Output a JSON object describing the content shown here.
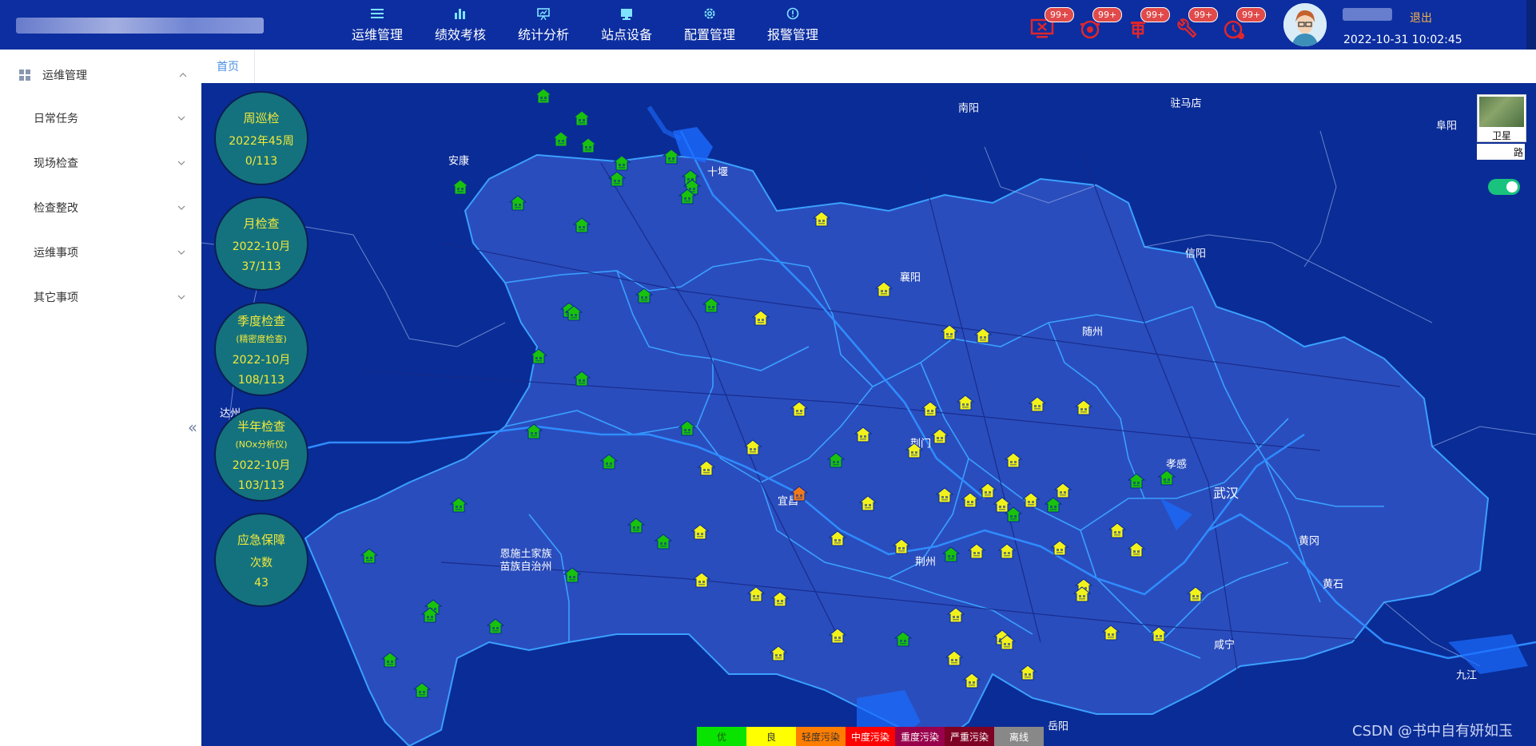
{
  "nav": {
    "items": [
      {
        "label": "运维管理",
        "icon": "list-icon"
      },
      {
        "label": "绩效考核",
        "icon": "bar-chart-icon"
      },
      {
        "label": "统计分析",
        "icon": "presentation-icon"
      },
      {
        "label": "站点设备",
        "icon": "monitor-icon"
      },
      {
        "label": "配置管理",
        "icon": "gear-icon"
      },
      {
        "label": "报警管理",
        "icon": "alert-icon"
      }
    ]
  },
  "alerts": [
    {
      "badge": "99+",
      "icon": "monitor-alert-icon"
    },
    {
      "badge": "99+",
      "icon": "camera-alert-icon"
    },
    {
      "badge": "99+",
      "icon": "audit-icon"
    },
    {
      "badge": "99+",
      "icon": "wrench-icon"
    },
    {
      "badge": "99+",
      "icon": "clock-alert-icon"
    }
  ],
  "header": {
    "logout": "退出",
    "datetime": "2022-10-31 10:02:45"
  },
  "sidebar": {
    "group": "运维管理",
    "items": [
      {
        "label": "日常任务"
      },
      {
        "label": "现场检查"
      },
      {
        "label": "检查整改"
      },
      {
        "label": "运维事项"
      },
      {
        "label": "其它事项"
      }
    ]
  },
  "tabs": [
    {
      "label": "首页"
    }
  ],
  "stats": [
    {
      "title": "周巡检",
      "sub": "",
      "line1": "2022年45周",
      "line2": "0/113"
    },
    {
      "title": "月检查",
      "sub": "",
      "line1": "2022-10月",
      "line2": "37/113"
    },
    {
      "title": "季度检查",
      "sub": "(精密度检查)",
      "line1": "2022-10月",
      "line2": "108/113"
    },
    {
      "title": "半年检查",
      "sub": "(NOx分析仪)",
      "line1": "2022-10月",
      "line2": "103/113"
    },
    {
      "title": "应急保障",
      "sub": "",
      "line1": "次数",
      "line2": "43"
    }
  ],
  "map": {
    "layer_label": "卫星",
    "layer_label2": "路",
    "cities": [
      {
        "name": "南阳"
      },
      {
        "name": "驻马店"
      },
      {
        "name": "阜阳"
      },
      {
        "name": "安康"
      },
      {
        "name": "十堰"
      },
      {
        "name": "襄阳"
      },
      {
        "name": "信阳"
      },
      {
        "name": "随州"
      },
      {
        "name": "达州"
      },
      {
        "name": "荆门"
      },
      {
        "name": "孝感"
      },
      {
        "name": "宜昌"
      },
      {
        "name": "武汉"
      },
      {
        "name": "黄冈"
      },
      {
        "name": "恩施土家族"
      },
      {
        "name": "苗族自治州"
      },
      {
        "name": "荆州"
      },
      {
        "name": "黄石"
      },
      {
        "name": "咸宁"
      },
      {
        "name": "九江"
      },
      {
        "name": "岳阳"
      }
    ],
    "colors": {
      "green": "#19c20c",
      "yellow": "#f2f21a",
      "orange": "#f07a1a"
    }
  },
  "legend": [
    {
      "label": "优",
      "color": "#08e400"
    },
    {
      "label": "良",
      "color": "#ffff00"
    },
    {
      "label": "轻度污染",
      "color": "#ff7e00"
    },
    {
      "label": "中度污染",
      "color": "#ff0000"
    },
    {
      "label": "重度污染",
      "color": "#99004c"
    },
    {
      "label": "严重污染",
      "color": "#7e0023"
    },
    {
      "label": "离线",
      "color": "#888888"
    }
  ],
  "watermark": "CSDN @书中自有妍如玉"
}
